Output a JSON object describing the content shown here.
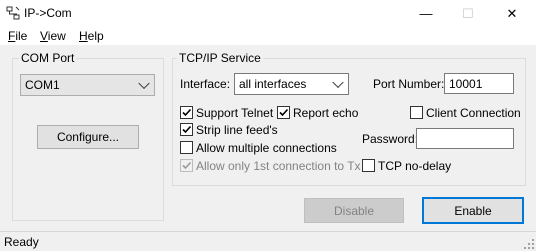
{
  "window": {
    "title": "IP->Com",
    "icon": "network-icon",
    "controls": {
      "minimize": "—",
      "maximize": "☐",
      "close": "✕"
    }
  },
  "menu": [
    {
      "label": "File"
    },
    {
      "label": "View"
    },
    {
      "label": "Help"
    }
  ],
  "com_port": {
    "group_label": "COM Port",
    "selected": "COM1",
    "configure_label": "Configure..."
  },
  "tcp": {
    "group_label": "TCP/IP Service",
    "interface_label": "Interface:",
    "interface_value": "all interfaces",
    "port_label": "Port Number:",
    "port_value": "10001",
    "password_label": "Password:",
    "password_value": "",
    "options": {
      "support_telnet": {
        "label": "Support Telnet",
        "checked": true
      },
      "report_echo": {
        "label": "Report echo",
        "checked": true
      },
      "strip_lf": {
        "label": "Strip line feed's",
        "checked": true
      },
      "allow_multiple": {
        "label": "Allow multiple connections",
        "checked": false
      },
      "allow_only_first": {
        "label": "Allow only 1st connection to Tx",
        "checked": true,
        "disabled": true
      },
      "client_connection": {
        "label": "Client Connection",
        "checked": false
      },
      "tcp_nodelay": {
        "label": "TCP no-delay",
        "checked": false
      }
    }
  },
  "buttons": {
    "disable": "Disable",
    "enable": "Enable"
  },
  "status": {
    "text": "Ready"
  },
  "colors": {
    "accent": "#0078d7",
    "window_bg": "#f0f0f0",
    "titlebar_bg": "#ffffff"
  }
}
